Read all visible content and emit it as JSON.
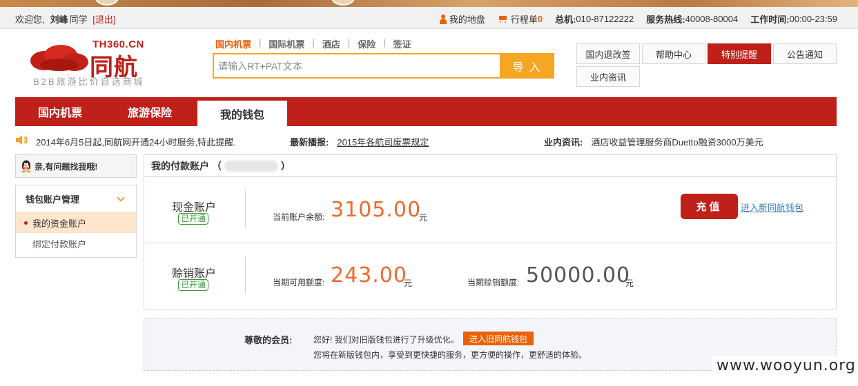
{
  "topbar": {
    "welcome": "欢迎您,",
    "user_name": "刘峰",
    "user_suffix": "同学",
    "logout": "[退出]",
    "my_area": "我的地盘",
    "itinerary": "行程单",
    "itinerary_count": "0",
    "switchboard_label": "总机:",
    "switchboard": "010-87122222",
    "hotline_label": "服务热线:",
    "hotline": "40008-80004",
    "hours_label": "工作时间:",
    "hours": "00:00-23:59"
  },
  "logo": {
    "domain": "TH360.CN",
    "name": "同航",
    "slogan": "B2B旅游比价自选商城"
  },
  "search": {
    "tabs": [
      "国内机票",
      "国际机票",
      "酒店",
      "保险",
      "签证"
    ],
    "placeholder": "请输入RT+PAT文本",
    "import_button": "导入"
  },
  "quick_links": [
    "国内退改签",
    "帮助中心",
    "特别提醒",
    "公告通知",
    "业内资讯"
  ],
  "nav": [
    "国内机票",
    "旅游保险",
    "我的钱包"
  ],
  "news": {
    "announcement": "2014年6月5日起,同航网开通24小时服务,特此提醒.",
    "latest_label": "最新播报:",
    "latest_link": "2015年各航司废票规定",
    "industry_label": "业内资讯:",
    "industry_text": "酒店收益管理服务商Duetto融资3000万美元"
  },
  "sidebar": {
    "qq_text": "亲,有问题找我哦!",
    "menu_title": "钱包账户管理",
    "items": [
      "我的资金账户",
      "绑定付款账户"
    ]
  },
  "account": {
    "title": "我的付款账户 （",
    "title_end": "）",
    "cash": {
      "name": "现金账户",
      "status": "已开通",
      "balance_label": "当前账户余额:",
      "balance": "3105.00",
      "unit": "元",
      "recharge": "充值",
      "new_wallet_link": "进入新同航钱包"
    },
    "credit": {
      "name": "赊销账户",
      "status": "已开通",
      "available_label": "当期可用额度:",
      "available": "243.00",
      "unit": "元",
      "limit_label": "当期赊销额度:",
      "limit": "50000.00",
      "limit_unit": "元"
    }
  },
  "notice": {
    "to": "尊敬的会员:",
    "line1": "您好! 我们对旧版钱包进行了升级优化。",
    "old_wallet_button": "进入旧同航钱包",
    "line2": "您将在新版钱包内，享受到更快捷的服务，更方便的操作，更舒适的体验。"
  },
  "watermark": "www.wooyun.org",
  "colors": {
    "brand_red": "#c0201a",
    "accent_orange": "#f5a623",
    "amount_orange": "#f0692d",
    "status_green": "#3a9a3a"
  }
}
